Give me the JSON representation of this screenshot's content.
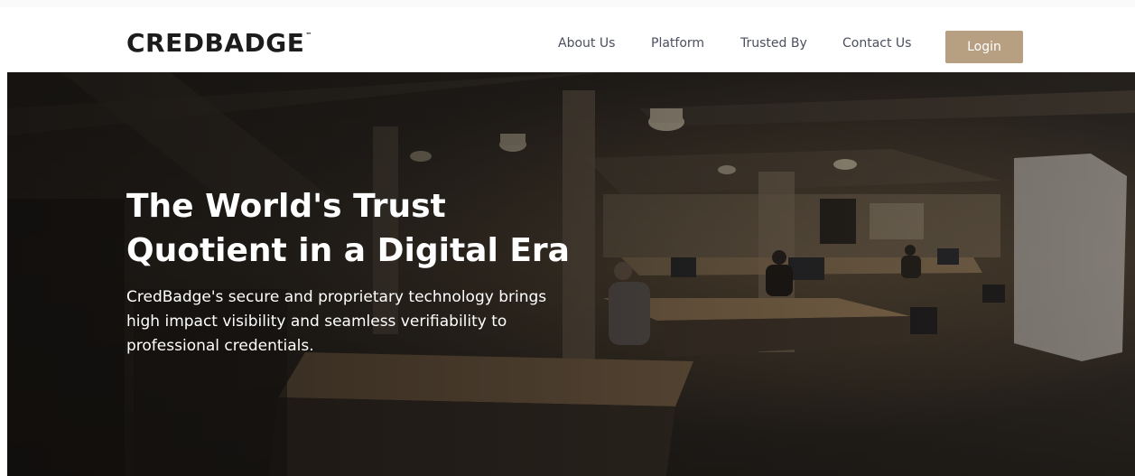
{
  "header": {
    "logo_text": "CREDBADGE",
    "logo_tm": "™",
    "nav": {
      "about": "About Us",
      "platform": "Platform",
      "trusted": "Trusted By",
      "contact": "Contact Us"
    },
    "login_label": "Login"
  },
  "hero": {
    "title_lines": [
      "The World's Trust",
      "Quotient in a Digital Era"
    ],
    "description_lines": [
      "CredBadge's secure and proprietary technology brings",
      "high impact visibility and seamless verifiability to",
      "professional credentials."
    ]
  },
  "colors": {
    "accent": "#b79f82",
    "nav_text": "#4b4f5e",
    "logo": "#1c1c1c",
    "hero_text": "#ffffff"
  }
}
